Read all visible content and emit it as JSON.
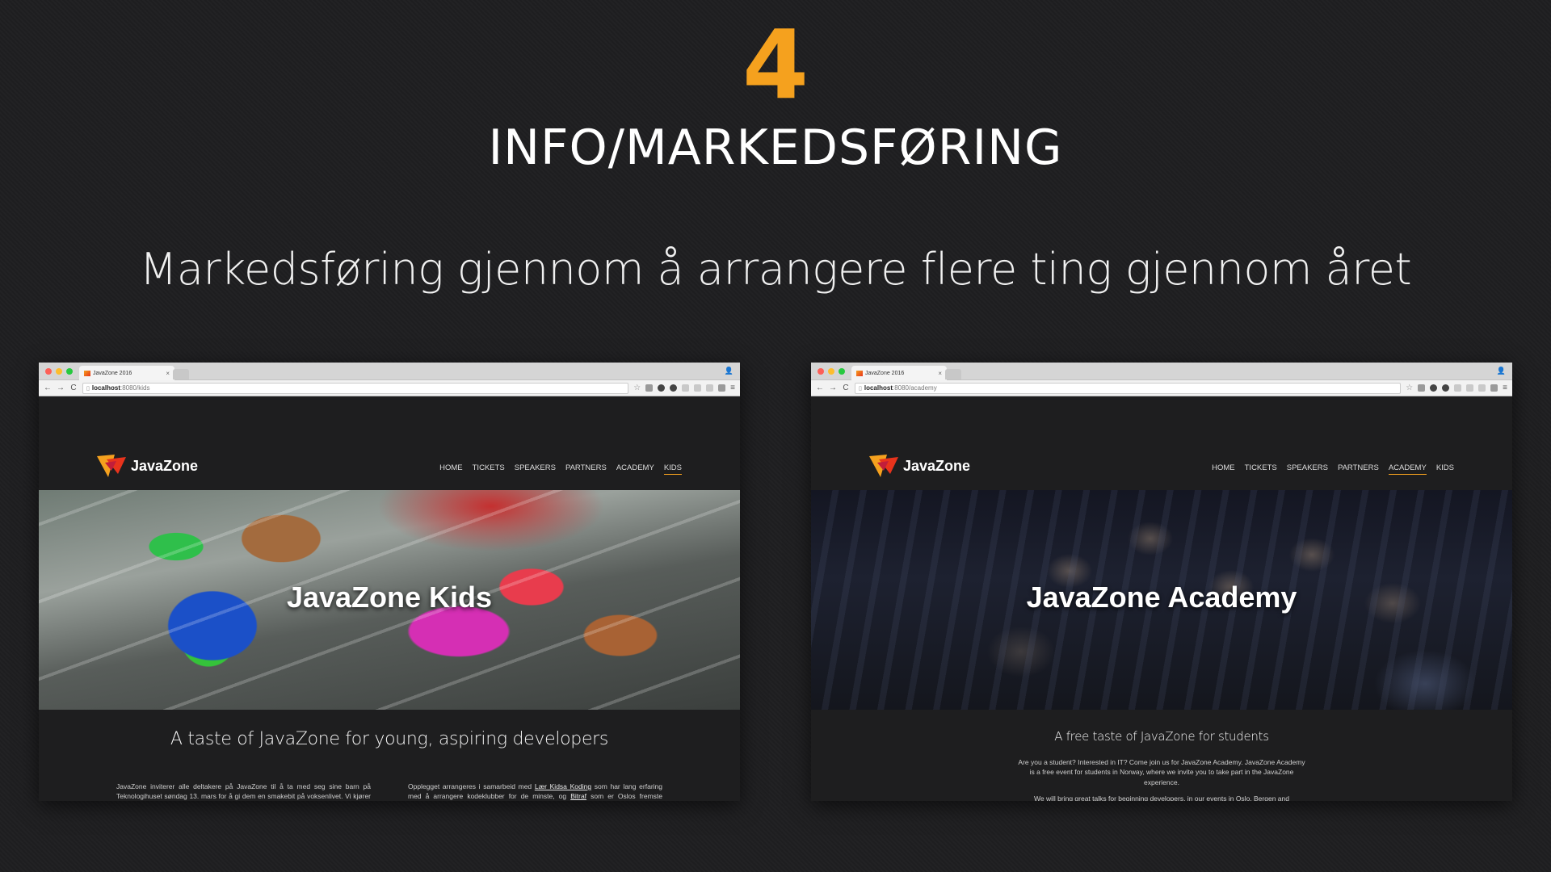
{
  "slide": {
    "number": "4",
    "title": "INFO/MARKEDSFØRING",
    "subtitle": "Markedsføring gjennom å arrangere flere ting gjennom året"
  },
  "browsers": [
    {
      "tab_title": "JavaZone 2016",
      "url_host": "localhost",
      "url_rest": ":8080/kids",
      "site_logo": "JavaZone",
      "nav": [
        "HOME",
        "TICKETS",
        "SPEAKERS",
        "PARTNERS",
        "ACADEMY",
        "KIDS"
      ],
      "active_nav": "KIDS",
      "hero_title": "JavaZone Kids",
      "tagline": "A taste of JavaZone for young, aspiring developers",
      "col1": "JavaZone inviterer alle deltakere på JavaZone til å ta med seg sine barn på Teknologihuset søndag 13. mars for å gi dem en smakebit på voksenlivet. Vi kjører to parallelle sesjoner slik at vi kan ha forskjellige opplegg for de eldste og de minste barna og ungdommene.",
      "col2_a": "Opplegget arrangeres i samarbeid med ",
      "col2_link1": "Lær Kidsa Koding",
      "col2_b": " som har lang erfaring med å arrangere kodeklubber for de minste, og ",
      "col2_link2": "Bitraf",
      "col2_c": " som er Oslos fremste eksperter på hacking og bygging."
    },
    {
      "tab_title": "JavaZone 2016",
      "url_host": "localhost",
      "url_rest": ":8080/academy",
      "site_logo": "JavaZone",
      "nav": [
        "HOME",
        "TICKETS",
        "SPEAKERS",
        "PARTNERS",
        "ACADEMY",
        "KIDS"
      ],
      "active_nav": "ACADEMY",
      "hero_title": "JavaZone Academy",
      "tagline": "A free taste of JavaZone for students",
      "paragraph": "Are you a student? Interested in IT? Come join us for JavaZone Academy. JavaZone Academy is a free event for students in Norway, where we invite you to take part in the JavaZone experience.",
      "paragraph2": "We will bring great talks for beginning developers, in our events in Oslo, Bergen and Trondheim."
    }
  ],
  "colors": {
    "accent": "#f5a11e",
    "background": "#1f1f21"
  }
}
